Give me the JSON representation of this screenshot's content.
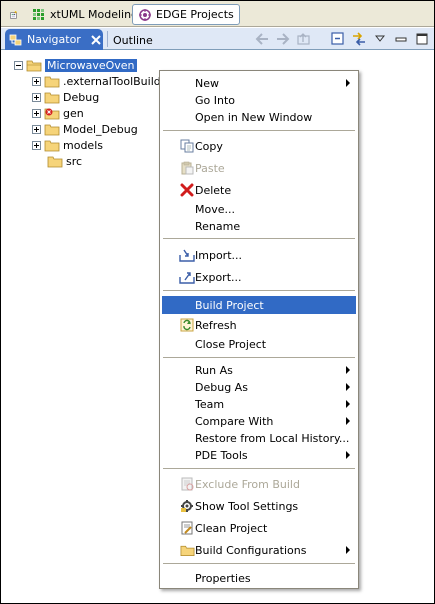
{
  "perspectives": {
    "items": [
      {
        "label": "xtUML Modeling"
      },
      {
        "label": "EDGE Projects"
      }
    ]
  },
  "views": {
    "tabs": [
      {
        "label": "Navigator"
      },
      {
        "label": "Outline"
      }
    ]
  },
  "tree": {
    "root": "MicrowaveOven",
    "children": [
      {
        "label": ".externalToolBuilders"
      },
      {
        "label": "Debug"
      },
      {
        "label": "gen"
      },
      {
        "label": "Model_Debug"
      },
      {
        "label": "models"
      },
      {
        "label": "src"
      }
    ]
  },
  "context_menu": {
    "highlighted": "Build Project",
    "items": [
      {
        "label": "New"
      },
      {
        "label": "Go Into"
      },
      {
        "label": "Open in New Window"
      },
      {
        "label": "Copy"
      },
      {
        "label": "Paste"
      },
      {
        "label": "Delete"
      },
      {
        "label": "Move..."
      },
      {
        "label": "Rename"
      },
      {
        "label": "Import..."
      },
      {
        "label": "Export..."
      },
      {
        "label": "Build Project"
      },
      {
        "label": "Refresh"
      },
      {
        "label": "Close Project"
      },
      {
        "label": "Run As"
      },
      {
        "label": "Debug As"
      },
      {
        "label": "Team"
      },
      {
        "label": "Compare With"
      },
      {
        "label": "Restore from Local History..."
      },
      {
        "label": "PDE Tools"
      },
      {
        "label": "Exclude From Build"
      },
      {
        "label": "Show Tool Settings"
      },
      {
        "label": "Clean Project"
      },
      {
        "label": "Build Configurations"
      },
      {
        "label": "Properties"
      }
    ]
  },
  "colors": {
    "selection": "#316ac5",
    "tab_active": "#3a6ec5",
    "disabled_text": "#aca899"
  }
}
